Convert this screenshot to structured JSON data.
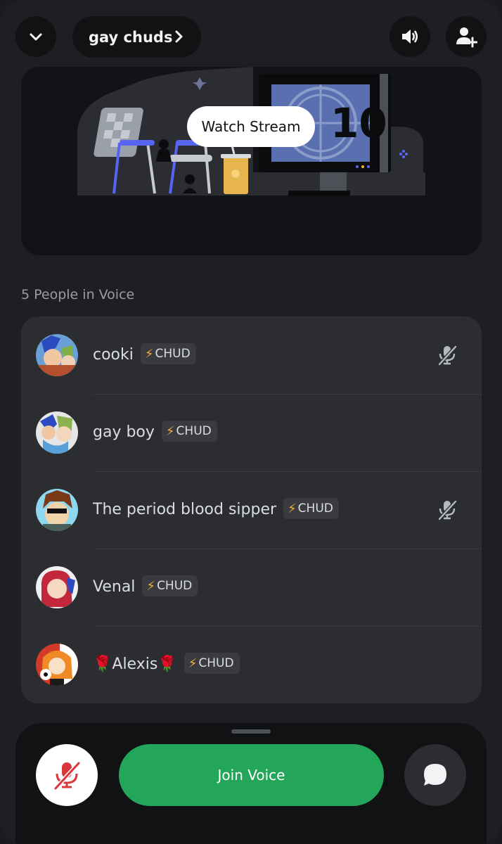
{
  "header": {
    "channel_name": "gay chuds",
    "icons": [
      "chevron-down-icon",
      "chevron-right-icon",
      "speaker-icon",
      "add-member-icon"
    ]
  },
  "stream": {
    "watch_label": "Watch Stream",
    "countdown_number": "10"
  },
  "voice": {
    "section_title": "5 People in Voice",
    "badge_label": "CHUD",
    "members": [
      {
        "name": "cooki",
        "muted": true
      },
      {
        "name": "gay boy",
        "muted": false
      },
      {
        "name": "The period blood sipper",
        "muted": true
      },
      {
        "name": "Venal",
        "muted": false
      },
      {
        "name": "🌹Alexis🌹",
        "muted": false
      }
    ]
  },
  "bottom": {
    "join_label": "Join Voice"
  },
  "colors": {
    "join_green": "#23a55a",
    "mute_red": "#da373c",
    "bolt_yellow": "#f0b232"
  }
}
